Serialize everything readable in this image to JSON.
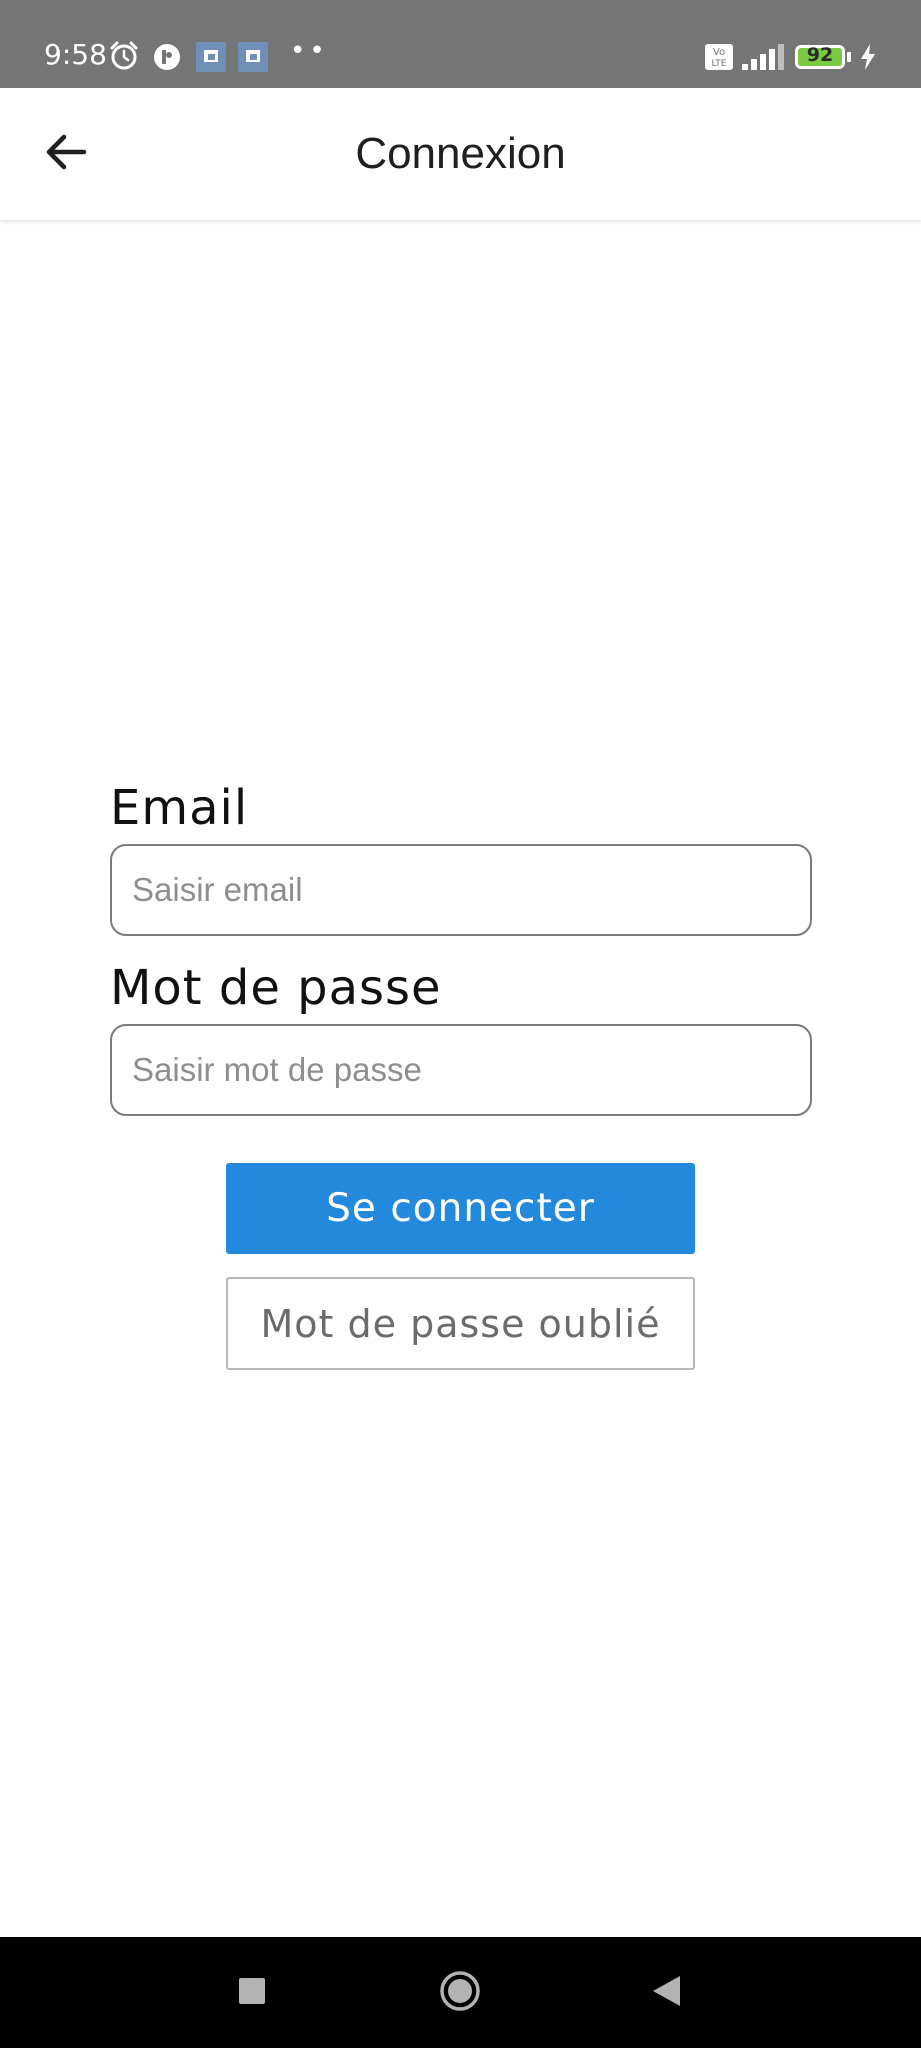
{
  "status_bar": {
    "time": "9:58",
    "battery_level": "92",
    "icons": [
      "alarm-icon",
      "app-notification-icon",
      "picture-notification-icon",
      "picture-notification-icon",
      "more-dots-icon",
      "volte-icon",
      "signal-icon",
      "battery-icon",
      "charging-icon"
    ],
    "network_label": "Vo LTE"
  },
  "app_bar": {
    "title": "Connexion",
    "back_icon": "arrow-left-icon"
  },
  "form": {
    "email_label": "Email",
    "email_placeholder": "Saisir email",
    "email_value": "",
    "password_label": "Mot de passe",
    "password_placeholder": "Saisir mot de passe",
    "password_value": "",
    "connect_button": "Se connecter",
    "forgot_button": "Mot de passe oublié"
  },
  "nav_bar": {
    "icons": [
      "recents-square-icon",
      "home-circle-icon",
      "back-triangle-icon"
    ]
  },
  "colors": {
    "status_bar": "#757575",
    "primary_button": "#2389dd",
    "battery": "#7ac943"
  }
}
